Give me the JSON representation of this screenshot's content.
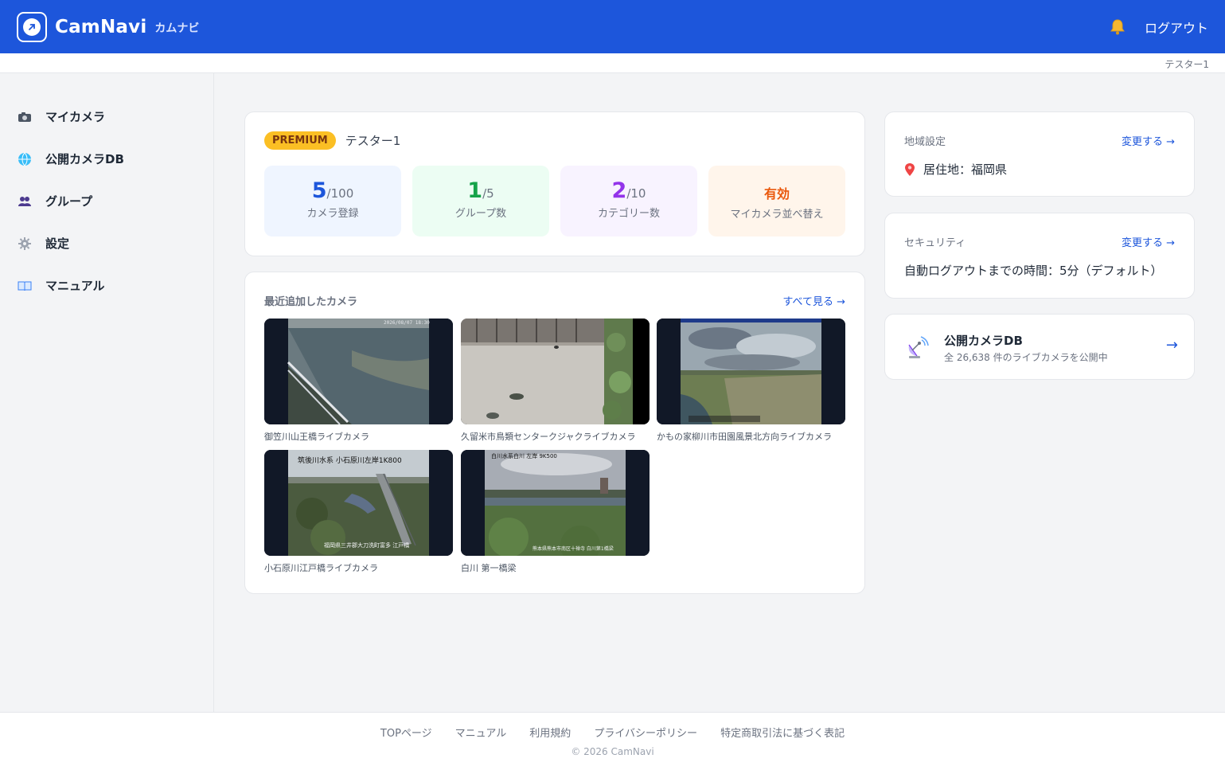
{
  "header": {
    "brand": "CamNavi",
    "brand_sub": "カムナビ",
    "logout": "ログアウト",
    "current_user": "テスター1"
  },
  "sidebar": {
    "items": [
      {
        "label": "マイカメラ",
        "icon": "camera-icon"
      },
      {
        "label": "公開カメラDB",
        "icon": "globe-icon"
      },
      {
        "label": "グループ",
        "icon": "group-icon"
      },
      {
        "label": "設定",
        "icon": "gear-icon"
      },
      {
        "label": "マニュアル",
        "icon": "book-icon"
      }
    ]
  },
  "plan": {
    "badge": "PREMIUM",
    "user": "テスター1",
    "stats": [
      {
        "value": "5",
        "limit": "/100",
        "label": "カメラ登録",
        "color": "#1d56db",
        "bg": "#eff5ff"
      },
      {
        "value": "1",
        "limit": "/5",
        "label": "グループ数",
        "color": "#16a34a",
        "bg": "#ecfdf3"
      },
      {
        "value": "2",
        "limit": "/10",
        "label": "カテゴリー数",
        "color": "#9333ea",
        "bg": "#f8f3ff"
      }
    ],
    "sort": {
      "value": "有効",
      "label": "マイカメラ並べ替え",
      "bg": "#fff5eb"
    }
  },
  "recent": {
    "title": "最近追加したカメラ",
    "see_all": "すべて見る →",
    "cameras": [
      {
        "caption": "御笠川山王橋ライブカメラ",
        "stamp": "2026/08/07 18:30"
      },
      {
        "caption": "久留米市鳥類センタークジャクライブカメラ",
        "stamp": ""
      },
      {
        "caption": "かもの家柳川市田園風景北方向ライブカメラ",
        "stamp": ""
      },
      {
        "caption": "小石原川江戸橋ライブカメラ",
        "stamp": "筑後川水系 小石原川左岸1K800",
        "stamp2": "福岡県三井郡大刀洗町富多 江戸橋"
      },
      {
        "caption": "白川 第一橋梁",
        "stamp": "白川水系白川 左岸 9K500",
        "stamp2": "熊本県熊本市南区十禅寺 白川第1橋梁"
      }
    ]
  },
  "region": {
    "label": "地域設定",
    "change": "変更する →",
    "value": "居住地：福岡県"
  },
  "security": {
    "label": "セキュリティ",
    "change": "変更する →",
    "value": "自動ログアウトまでの時間：5分（デフォルト）"
  },
  "publicdb": {
    "title": "公開カメラDB",
    "sub": "全 26,638 件のライブカメラを公開中",
    "arrow": "→"
  },
  "footer": {
    "links": [
      "TOPページ",
      "マニュアル",
      "利用規約",
      "プライバシーポリシー",
      "特定商取引法に基づく表記"
    ],
    "copyright": "© 2026 CamNavi"
  },
  "colors": {
    "accent": "#1d56db",
    "premium": "#fbbf24",
    "enabled": "#ea580c"
  }
}
